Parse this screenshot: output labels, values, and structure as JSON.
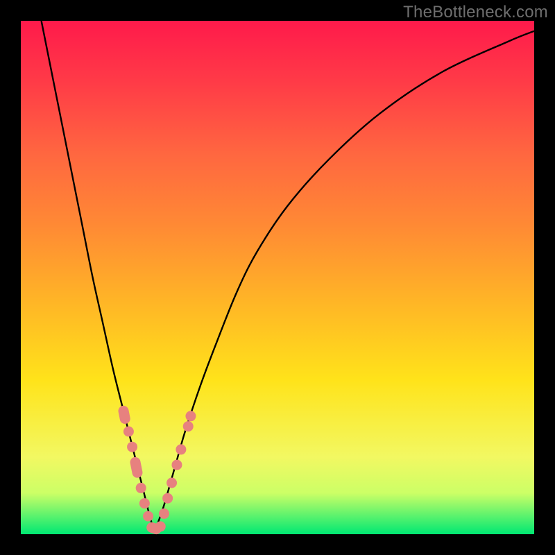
{
  "watermark": "TheBottleneck.com",
  "colors": {
    "curve_stroke": "#000000",
    "marker_fill": "#e7817f",
    "marker_stroke": "#e7817f"
  },
  "chart_data": {
    "type": "line",
    "title": "",
    "xlabel": "",
    "ylabel": "",
    "xlim": [
      0,
      100
    ],
    "ylim": [
      0,
      100
    ],
    "curve": {
      "description": "V-shaped bottleneck curve with apex near x≈26, y≈0 and both arms rising to top",
      "x": [
        4,
        6,
        8,
        10,
        12,
        14,
        16,
        18,
        20,
        22,
        24,
        25,
        26,
        27,
        28,
        30,
        32,
        35,
        38,
        42,
        46,
        52,
        60,
        70,
        82,
        95,
        100
      ],
      "y": [
        100,
        90,
        80,
        70,
        60,
        50,
        41,
        32,
        24,
        16,
        8,
        4,
        1,
        3,
        6,
        13,
        20,
        29,
        37,
        47,
        55,
        64,
        73,
        82,
        90,
        96,
        98
      ]
    },
    "markers": {
      "left_arm": [
        {
          "x": 20.0,
          "y": 24.0
        },
        {
          "x": 20.3,
          "y": 22.5
        },
        {
          "x": 21.0,
          "y": 20.0
        },
        {
          "x": 21.7,
          "y": 17.0
        },
        {
          "x": 22.3,
          "y": 14.0
        },
        {
          "x": 22.7,
          "y": 12.0
        },
        {
          "x": 23.4,
          "y": 9.0
        },
        {
          "x": 24.1,
          "y": 6.0
        },
        {
          "x": 24.8,
          "y": 3.5
        }
      ],
      "apex": [
        {
          "x": 25.5,
          "y": 1.3
        },
        {
          "x": 26.4,
          "y": 1.0
        },
        {
          "x": 27.2,
          "y": 1.5
        }
      ],
      "right_arm": [
        {
          "x": 27.9,
          "y": 4.0
        },
        {
          "x": 28.6,
          "y": 7.0
        },
        {
          "x": 29.4,
          "y": 10.0
        },
        {
          "x": 30.4,
          "y": 13.5
        },
        {
          "x": 31.2,
          "y": 16.5
        },
        {
          "x": 32.6,
          "y": 21.0
        },
        {
          "x": 33.1,
          "y": 23.0
        }
      ]
    }
  }
}
